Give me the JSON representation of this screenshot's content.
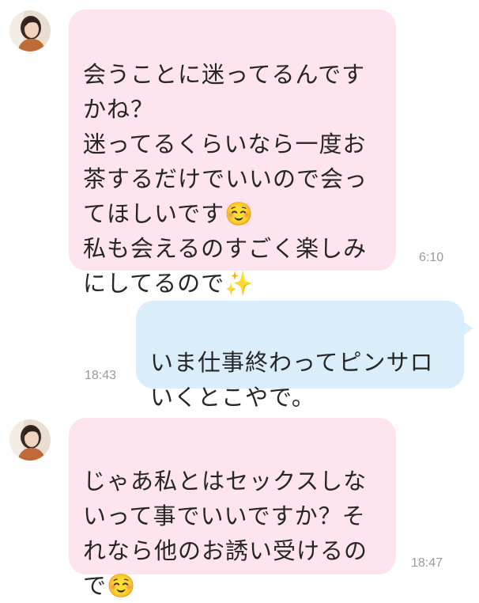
{
  "messages": [
    {
      "direction": "incoming",
      "text": "会うことに迷ってるんです\nかね？\n迷ってるくらいなら一度お\n茶するだけでいいので会っ\nてほしいです☺️\n私も会えるのすごく楽しみ\nにしてるので✨",
      "time": "6:10"
    },
    {
      "direction": "outgoing",
      "text": "いま仕事終わってピンサロ\nいくとこやで。",
      "time": "18:43"
    },
    {
      "direction": "incoming",
      "text": "じゃあ私とはセックスしな\nいって事でいいですか？そ\nれなら他のお誘い受けるの\nで☺️",
      "time": "18:47"
    }
  ],
  "colors": {
    "incoming_bubble": "#fde4ee",
    "outgoing_bubble": "#daedfb",
    "timestamp": "#9a9a9a",
    "text": "#262626"
  }
}
